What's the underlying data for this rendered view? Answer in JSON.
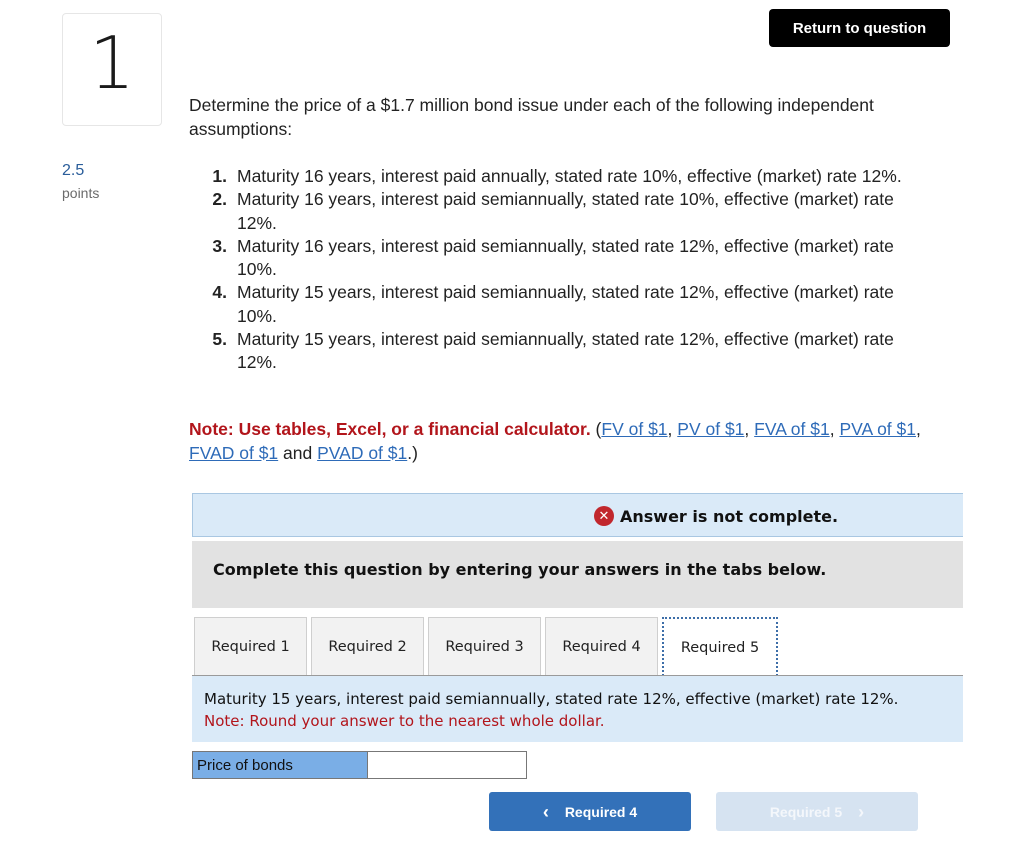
{
  "question": {
    "number": "1",
    "points_value": "2.5",
    "points_label": "points",
    "return_button": "Return to question",
    "intro": "Determine the price of a $1.7 million bond issue under each of the following independent assumptions:",
    "conditions": [
      {
        "num": "1.",
        "text": "Maturity 16 years, interest paid annually, stated rate 10%, effective (market) rate 12%."
      },
      {
        "num": "2.",
        "text": "Maturity 16 years, interest paid semiannually, stated rate 10%, effective (market) rate 12%."
      },
      {
        "num": "3.",
        "text": "Maturity 16 years, interest paid semiannually, stated rate 12%, effective (market) rate 10%."
      },
      {
        "num": "4.",
        "text": "Maturity 15 years, interest paid semiannually, stated rate 12%, effective (market) rate 10%."
      },
      {
        "num": "5.",
        "text": "Maturity 15 years, interest paid semiannually, stated rate 12%, effective (market) rate 12%."
      }
    ],
    "note": {
      "bold": "Note: Use tables, Excel, or a financial calculator.",
      "open_paren": " (",
      "links": [
        "FV of $1",
        "PV of $1",
        "FVA of $1",
        "PVA of $1",
        "FVAD of $1",
        "PVAD of $1"
      ],
      "sep": ", ",
      "and": " and ",
      "close": ".)"
    }
  },
  "status": {
    "icon": "x-circle-icon",
    "text": "Answer is not complete."
  },
  "instruction": "Complete this question by entering your answers in the tabs below.",
  "tabs": [
    {
      "label": "Required 1",
      "active": false
    },
    {
      "label": "Required 2",
      "active": false
    },
    {
      "label": "Required 3",
      "active": false
    },
    {
      "label": "Required 4",
      "active": false
    },
    {
      "label": "Required 5",
      "active": true
    }
  ],
  "panel": {
    "description": "Maturity 15 years, interest paid semiannually, stated rate 12%, effective (market) rate 12%.",
    "note": "Note: Round your answer to the nearest whole dollar.",
    "answer_label": "Price of bonds",
    "answer_value": ""
  },
  "nav": {
    "prev_label": "Required 4",
    "prev_chevron": "‹",
    "next_label": "Required 5",
    "next_chevron": "›"
  },
  "colors": {
    "accent_blue": "#3371b9",
    "error_red": "#b2151b",
    "panel_blue": "#daeaf8",
    "label_blue": "#7aaee6"
  }
}
